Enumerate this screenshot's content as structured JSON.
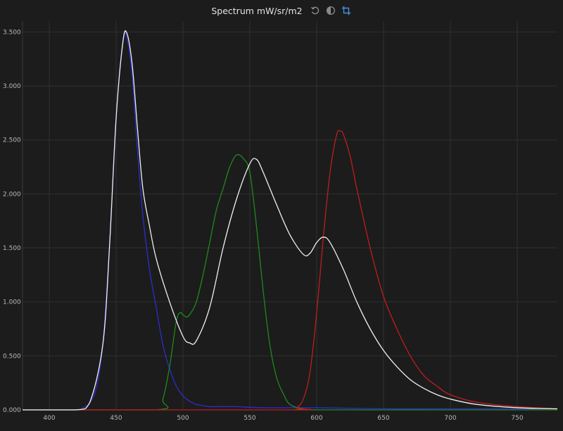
{
  "title": "Spectrum mW/sr/m2",
  "toolbar": {
    "icons": [
      "reset-icon",
      "contrast-icon",
      "crop-icon"
    ],
    "accent_color": "#4a90d9"
  },
  "chart_data": {
    "type": "line",
    "title": "Spectrum mW/sr/m2",
    "xlabel": "",
    "ylabel": "",
    "xlim": [
      380,
      780
    ],
    "ylim": [
      0,
      3.6
    ],
    "x_ticks": [
      "400",
      "450",
      "500",
      "550",
      "600",
      "650",
      "700",
      "750"
    ],
    "x_tick_values": [
      400,
      450,
      500,
      550,
      600,
      650,
      700,
      750
    ],
    "y_ticks": [
      "0.000",
      "0.500",
      "1.000",
      "1.500",
      "2.000",
      "2.500",
      "3.000",
      "3.500"
    ],
    "y_tick_values": [
      0,
      0.5,
      1.0,
      1.5,
      2.0,
      2.5,
      3.0,
      3.5
    ],
    "grid": true,
    "background": "#1c1c1c",
    "series": [
      {
        "color": "#2d2dcf",
        "x": [
          380,
          420,
          425,
          430,
          435,
          440,
          445,
          450,
          455,
          458,
          462,
          466,
          470,
          475,
          480,
          485,
          490,
          495,
          500,
          505,
          510,
          515,
          520,
          530,
          540,
          560,
          600,
          650,
          700,
          780
        ],
        "y": [
          0.0,
          0.0,
          0.02,
          0.06,
          0.2,
          0.6,
          1.5,
          2.7,
          3.4,
          3.45,
          3.1,
          2.4,
          1.8,
          1.3,
          0.95,
          0.6,
          0.38,
          0.22,
          0.13,
          0.08,
          0.05,
          0.04,
          0.03,
          0.03,
          0.03,
          0.02,
          0.02,
          0.01,
          0.01,
          0.01
        ]
      },
      {
        "color": "#1d8a1d",
        "x": [
          380,
          480,
          485,
          490,
          495,
          498,
          500,
          503,
          506,
          510,
          515,
          520,
          525,
          530,
          535,
          540,
          545,
          550,
          555,
          560,
          565,
          570,
          575,
          580,
          590,
          600,
          780
        ],
        "y": [
          0.0,
          0.0,
          0.1,
          0.4,
          0.82,
          0.9,
          0.88,
          0.86,
          0.9,
          1.0,
          1.25,
          1.55,
          1.85,
          2.05,
          2.25,
          2.36,
          2.33,
          2.2,
          1.7,
          1.1,
          0.6,
          0.3,
          0.15,
          0.05,
          0.01,
          0.0,
          0.0
        ]
      },
      {
        "color": "#c01c1c",
        "x": [
          380,
          580,
          585,
          590,
          595,
          600,
          605,
          610,
          615,
          618,
          620,
          625,
          630,
          640,
          650,
          660,
          670,
          680,
          690,
          700,
          720,
          750,
          780
        ],
        "y": [
          0.0,
          0.0,
          0.02,
          0.1,
          0.35,
          0.9,
          1.6,
          2.2,
          2.55,
          2.58,
          2.55,
          2.35,
          2.05,
          1.5,
          1.05,
          0.75,
          0.5,
          0.32,
          0.22,
          0.14,
          0.07,
          0.03,
          0.01
        ]
      },
      {
        "color": "#f0f0f0",
        "x": [
          380,
          420,
          430,
          440,
          445,
          450,
          455,
          458,
          462,
          466,
          470,
          475,
          480,
          490,
          500,
          505,
          510,
          520,
          530,
          540,
          550,
          555,
          560,
          570,
          580,
          590,
          595,
          600,
          605,
          610,
          620,
          630,
          640,
          650,
          660,
          670,
          680,
          690,
          700,
          720,
          750,
          780
        ],
        "y": [
          0.0,
          0.0,
          0.06,
          0.6,
          1.5,
          2.7,
          3.4,
          3.49,
          3.2,
          2.6,
          2.05,
          1.7,
          1.4,
          1.0,
          0.68,
          0.62,
          0.64,
          0.95,
          1.5,
          1.95,
          2.28,
          2.32,
          2.2,
          1.9,
          1.62,
          1.44,
          1.45,
          1.55,
          1.6,
          1.55,
          1.3,
          1.0,
          0.75,
          0.55,
          0.4,
          0.28,
          0.2,
          0.14,
          0.1,
          0.05,
          0.02,
          0.01
        ]
      }
    ]
  }
}
